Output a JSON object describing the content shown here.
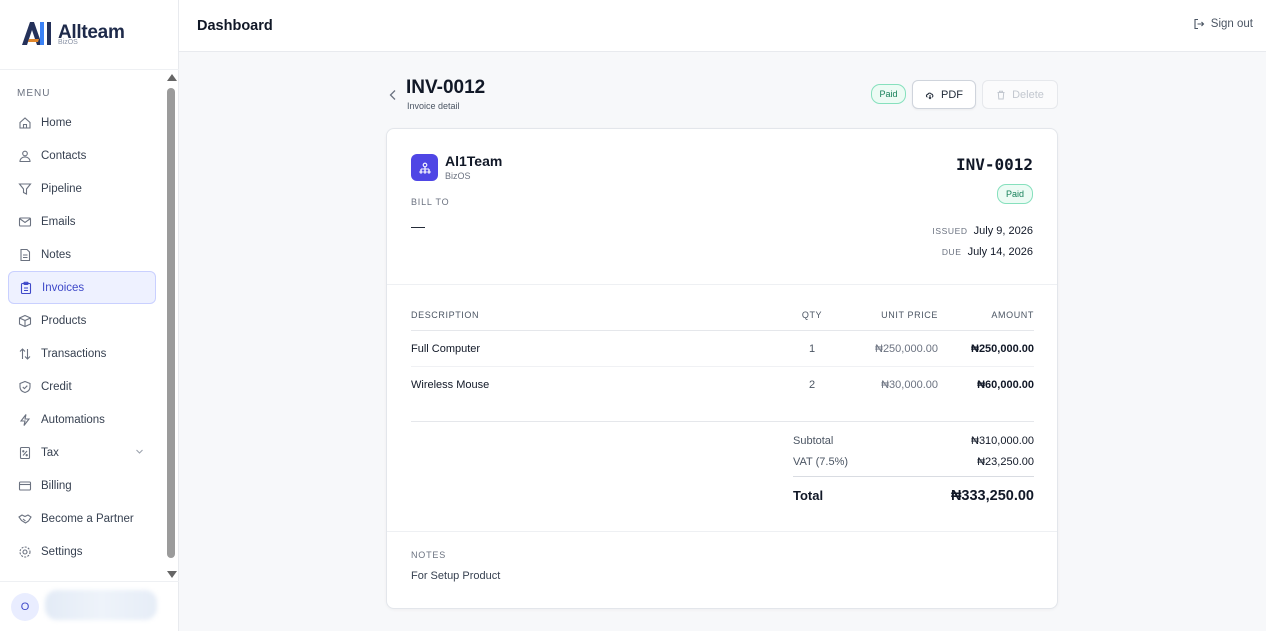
{
  "brand": {
    "name": "Allteam",
    "sub": "BizOS"
  },
  "sidebar": {
    "menu_label": "MENU",
    "items": [
      {
        "label": "Home",
        "icon": "home-icon"
      },
      {
        "label": "Contacts",
        "icon": "contacts-icon"
      },
      {
        "label": "Pipeline",
        "icon": "funnel-icon"
      },
      {
        "label": "Emails",
        "icon": "mail-icon"
      },
      {
        "label": "Notes",
        "icon": "note-icon"
      },
      {
        "label": "Invoices",
        "icon": "clipboard-icon",
        "active": true
      },
      {
        "label": "Products",
        "icon": "box-icon"
      },
      {
        "label": "Transactions",
        "icon": "arrows-updown-icon"
      },
      {
        "label": "Credit",
        "icon": "shield-icon"
      },
      {
        "label": "Automations",
        "icon": "bolt-icon"
      },
      {
        "label": "Tax",
        "icon": "tax-icon",
        "has_chevron": true
      },
      {
        "label": "Billing",
        "icon": "card-icon"
      },
      {
        "label": "Become a Partner",
        "icon": "handshake-icon"
      },
      {
        "label": "Settings",
        "icon": "gear-icon"
      }
    ],
    "user_initial": "O"
  },
  "topbar": {
    "title": "Dashboard",
    "signout_label": "Sign out"
  },
  "invoice": {
    "id": "INV-0012",
    "subtitle": "Invoice detail",
    "status": "Paid",
    "pdf_label": "PDF",
    "delete_label": "Delete",
    "company": {
      "name": "Al1Team",
      "sub": "BizOS"
    },
    "bill_to_label": "BILL TO",
    "bill_to_value": "—",
    "issued_label": "ISSUED",
    "issued_date": "July 9, 2026",
    "due_label": "DUE",
    "due_date": "July 14, 2026",
    "columns": {
      "desc": "DESCRIPTION",
      "qty": "QTY",
      "unit": "UNIT PRICE",
      "amount": "AMOUNT"
    },
    "items": [
      {
        "desc": "Full Computer",
        "qty": "1",
        "unit": "₦250,000.00",
        "amount": "₦250,000.00"
      },
      {
        "desc": "Wireless Mouse",
        "qty": "2",
        "unit": "₦30,000.00",
        "amount": "₦60,000.00"
      }
    ],
    "subtotal_label": "Subtotal",
    "subtotal": "₦310,000.00",
    "vat_label": "VAT (7.5%)",
    "vat": "₦23,250.00",
    "total_label": "Total",
    "total": "₦333,250.00",
    "notes_label": "NOTES",
    "notes": "For Setup Product"
  },
  "colors": {
    "accent": "#4f46e5",
    "active_bg": "#eef1ff",
    "paid_green": "#17815a"
  }
}
